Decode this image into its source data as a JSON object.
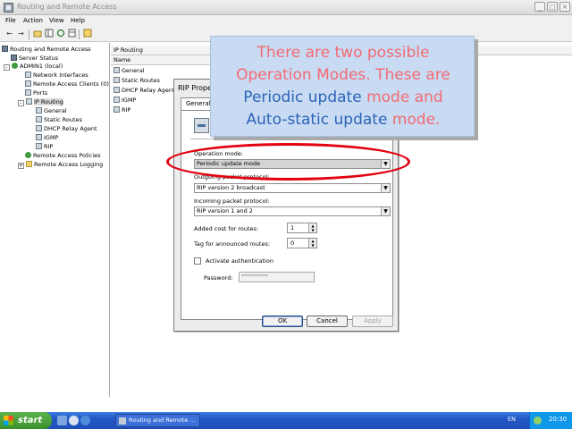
{
  "window": {
    "title": "Routing and Remote Access",
    "controls": {
      "minimize": "_",
      "maximize": "□",
      "close": "×"
    }
  },
  "menubar": [
    "File",
    "Action",
    "View",
    "Help"
  ],
  "toolbar": {
    "back": "←",
    "forward": "→"
  },
  "tree": {
    "header": "Routing and Remote Access",
    "items": [
      {
        "label": "Server Status"
      },
      {
        "label": "ADMIN1 (local)"
      },
      {
        "label": "Network Interfaces"
      },
      {
        "label": "Remote Access Clients (0)"
      },
      {
        "label": "Ports"
      },
      {
        "label": "IP Routing"
      },
      {
        "label": "General"
      },
      {
        "label": "Static Routes"
      },
      {
        "label": "DHCP Relay Agent"
      },
      {
        "label": "IGMP"
      },
      {
        "label": "RIP"
      },
      {
        "label": "Remote Access Policies"
      },
      {
        "label": "Remote Access Logging"
      }
    ]
  },
  "list": {
    "header": "IP Routing",
    "column": "Name",
    "rows": [
      "General",
      "Static Routes",
      "DHCP Relay Agent",
      "IGMP",
      "RIP"
    ]
  },
  "dialog": {
    "title": "RIP Prope",
    "tab": "General",
    "operation_mode_label": "Operation mode:",
    "operation_mode_value": "Periodic update mode",
    "outgoing_label": "Outgoing packet protocol:",
    "outgoing_value": "RIP version 2 broadcast",
    "incoming_label": "Incoming packet protocol:",
    "incoming_value": "RIP version 1 and 2",
    "added_cost_label": "Added cost for routes:",
    "added_cost_value": "1",
    "tag_label": "Tag for announced routes:",
    "tag_value": "0",
    "auth_label": "Activate authentication",
    "password_label": "Password:",
    "password_value": "**********",
    "ok": "OK",
    "cancel": "Cancel",
    "apply": "Apply"
  },
  "callout": {
    "line1": "There are two possible",
    "line2": "Operation Modes. These are",
    "line3_a": "Periodic update",
    "line3_b": " mode and",
    "line4_a": "Auto-static update",
    "line4_b": " mode."
  },
  "taskbar": {
    "start": "start",
    "task": "Routing and Remote ...",
    "lang": "EN",
    "clock": "20:30"
  }
}
